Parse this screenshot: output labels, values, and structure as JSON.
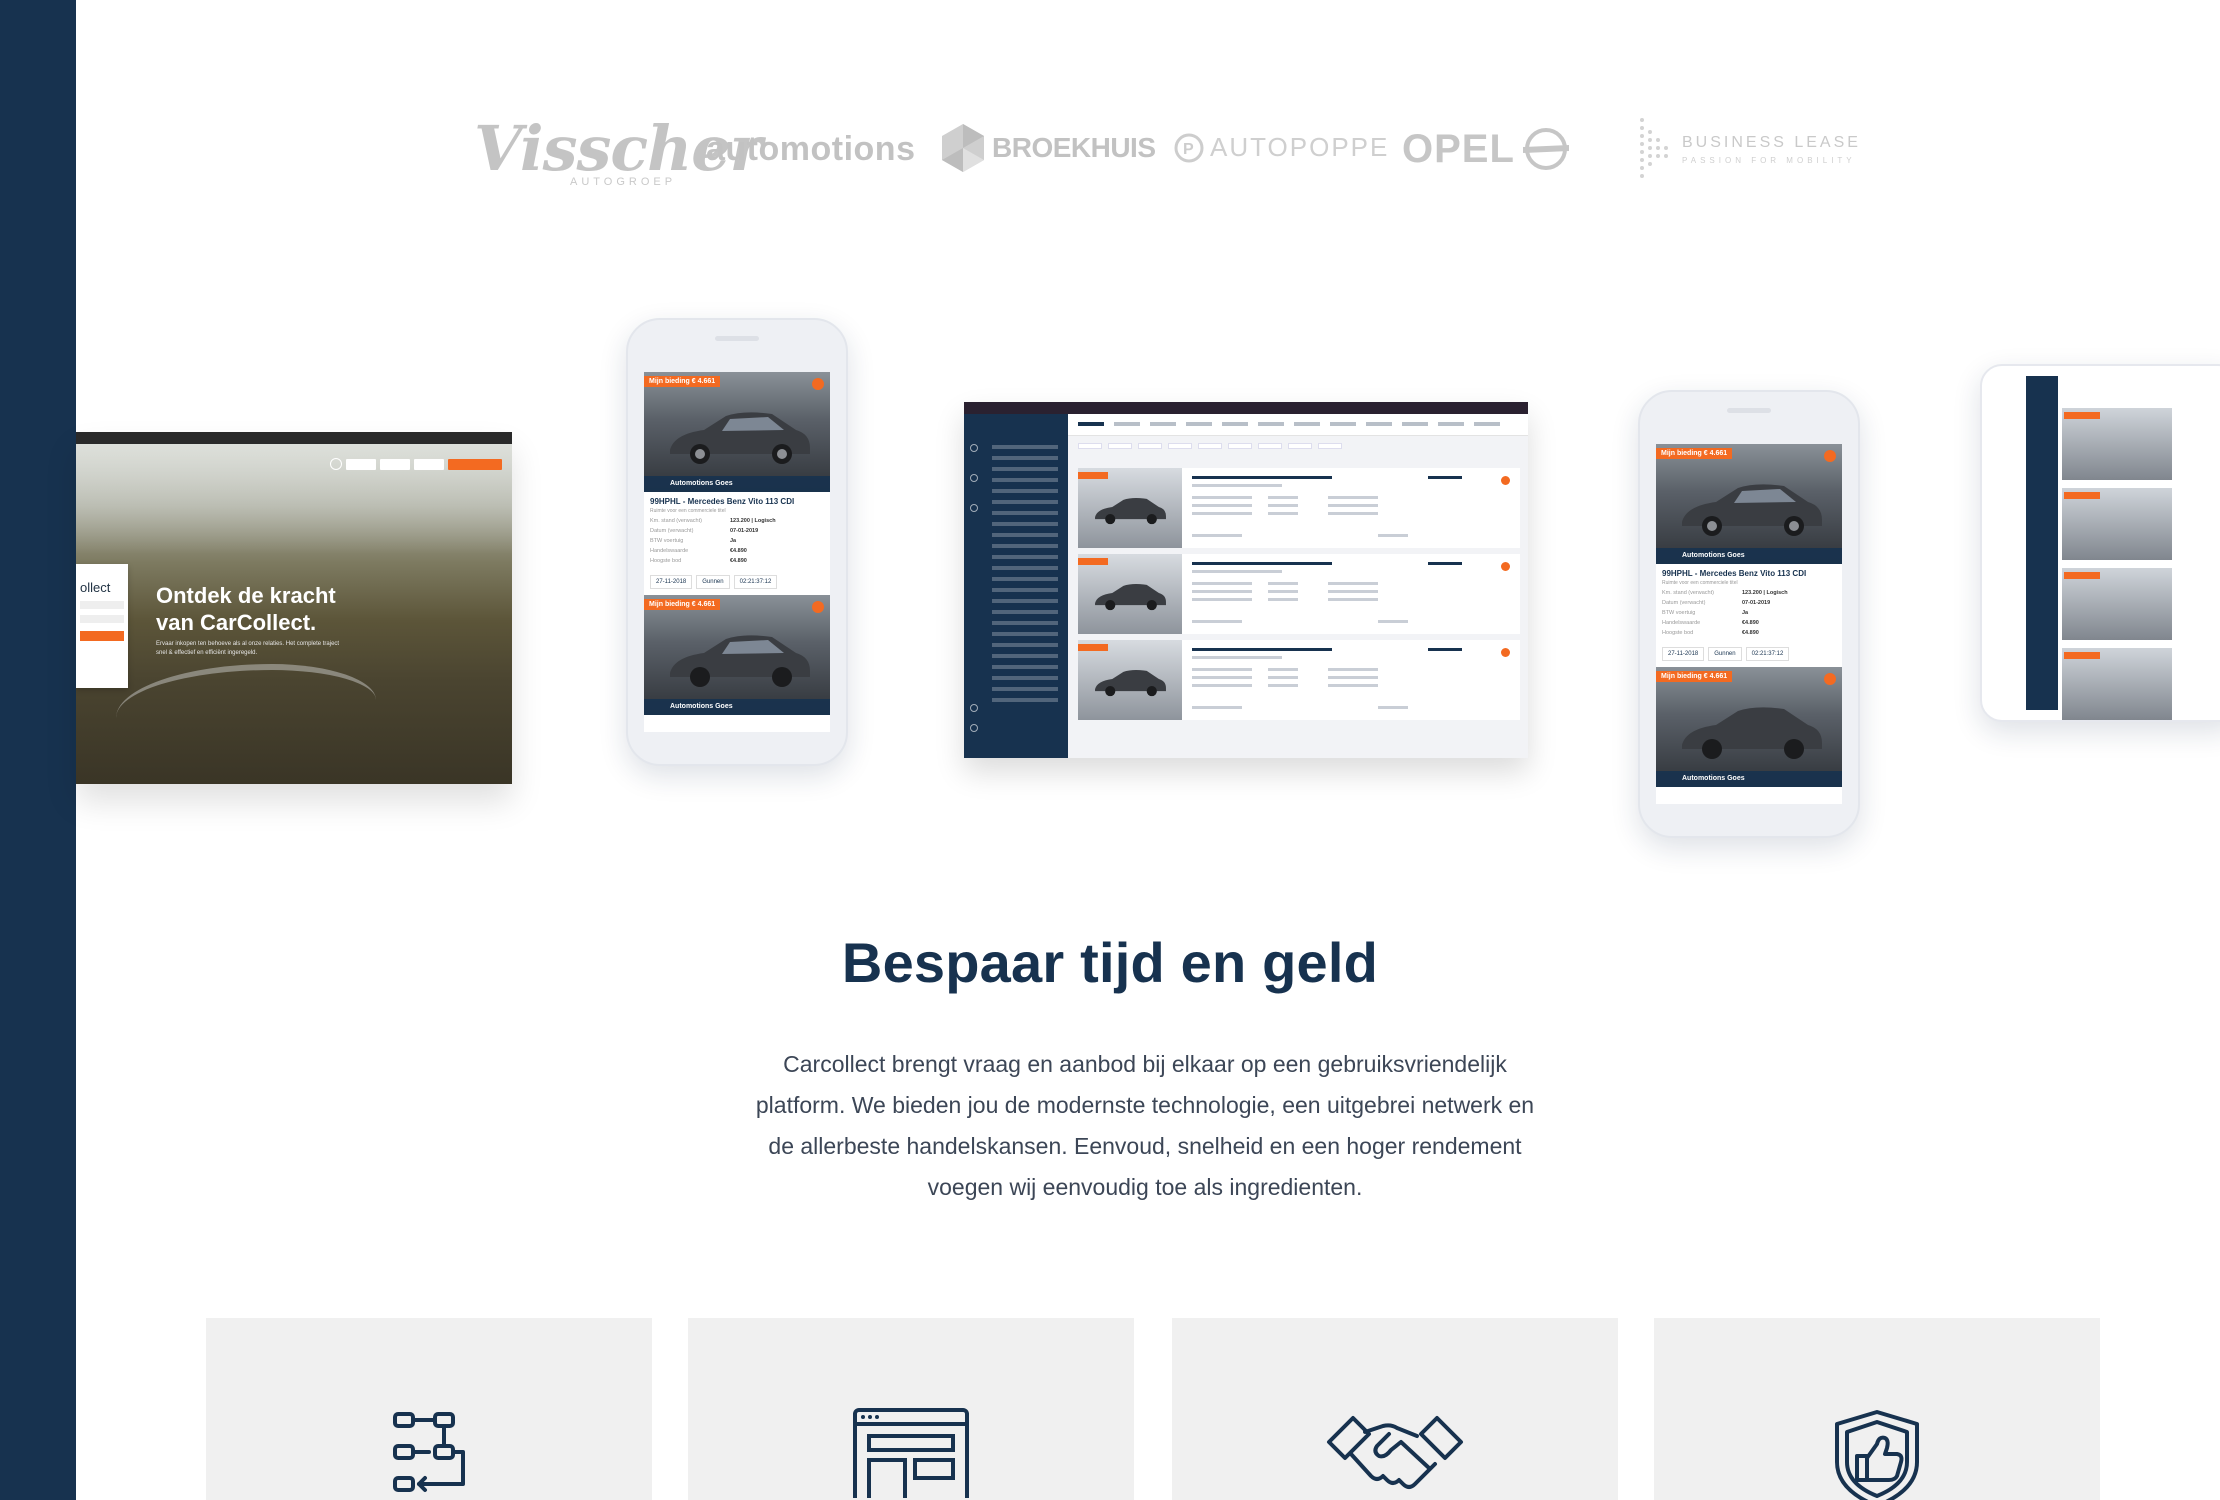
{
  "logos": {
    "visscher": "Visscher",
    "visscher_sub": "AUTOGROEP",
    "automotions": "automotions",
    "broekhuis": "BROEKHUIS",
    "autopoppe": "AUTOPOPPE",
    "opel": "OPEL",
    "business_lease": "BUSINESS LEASE",
    "business_lease_sub": "PASSION FOR MOBILITY"
  },
  "laptop": {
    "headline": "Ontdek de kracht van CarCollect.",
    "subtext": "Ervaar inkopen ten behoeve als al onze relaties. Het complete traject snel & effectief en efficiënt ingeregeld.",
    "login_brand": "ollect"
  },
  "phone_card": {
    "badge": "Mijn bieding  € 4.661",
    "dealer": "Automotions Goes",
    "title": "99HPHL - Mercedes Benz Vito 113 CDI",
    "subtitle": "Ruimte voor een commerciele titel",
    "rows": [
      {
        "k": "Km. stand (verwacht)",
        "v": "123.200 | Logisch"
      },
      {
        "k": "Datum (verwacht)",
        "v": "07-01-2019"
      },
      {
        "k": "BTW voertuig",
        "v": "Ja"
      },
      {
        "k": "Handelswaarde",
        "v": "€4.890"
      },
      {
        "k": "Hoogste bod",
        "v": "€4.890"
      }
    ],
    "date": "27-11-2018",
    "place": "Gunnen",
    "timer": "02:21:37:12"
  },
  "main": {
    "title": "Bespaar tijd en geld",
    "body": "Carcollect brengt vraag en aanbod bij elkaar op een gebruiksvriendelijk platform. We bieden jou de modernste technologie, een uitgebrei netwerk en de allerbeste handelskansen. Eenvoud, snelheid en een hoger rendement voegen wij eenvoudig toe als ingredienten."
  },
  "features": [
    {
      "icon": "flow-icon"
    },
    {
      "icon": "browser-window-icon"
    },
    {
      "icon": "handshake-icon"
    },
    {
      "icon": "shield-thumbs-up-icon"
    }
  ],
  "colors": {
    "navy": "#17324f",
    "orange": "#f36a21",
    "logo_grey": "#c4c4c4",
    "card_bg": "#f0f0f0"
  }
}
